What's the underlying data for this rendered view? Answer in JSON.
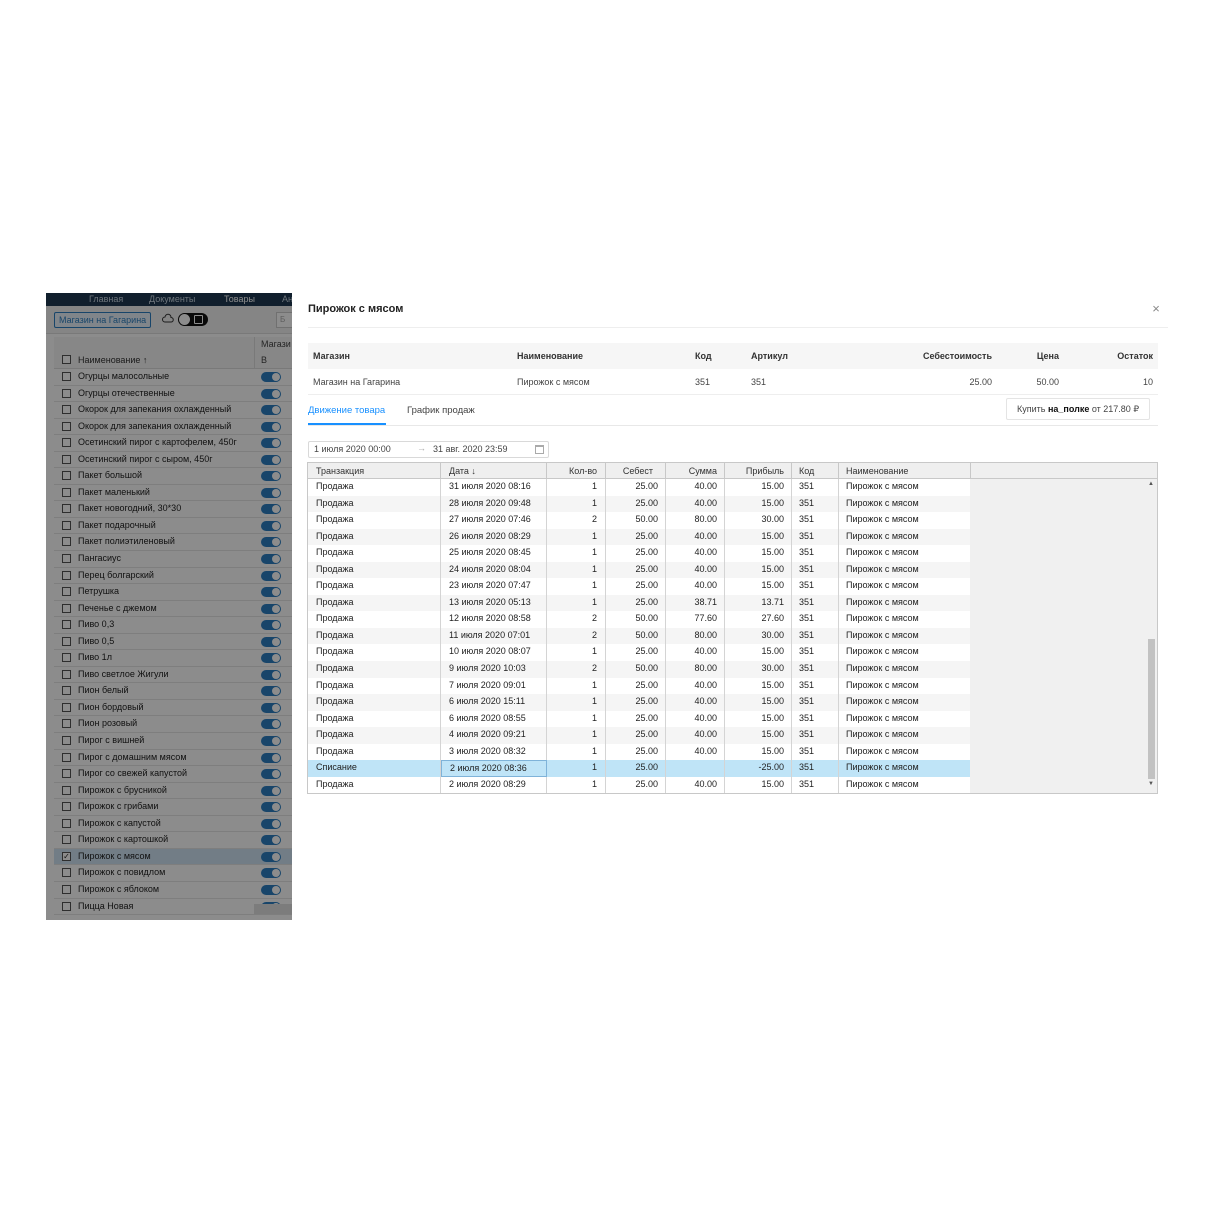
{
  "app": {
    "nav": [
      "Главная",
      "Документы",
      "Товары",
      "Ан"
    ],
    "store_button": "Магазин на Гагарина",
    "search_placeholder": "Б",
    "list_header": {
      "stores_col": "Магази",
      "b_col": "В",
      "name_col": "Наименование ↑"
    },
    "products": [
      "Огурцы малосольные",
      "Огурцы отечественные",
      "Окорок для запекания охлажденный",
      "Окорок для запекания охлажденный",
      "Осетинский пирог с картофелем, 450г",
      "Осетинский пирог с сыром, 450г",
      "Пакет большой",
      "Пакет маленький",
      "Пакет новогодний, 30*30",
      "Пакет подарочный",
      "Пакет полиэтиленовый",
      "Пангасиус",
      "Перец болгарский",
      "Петрушка",
      "Печенье с джемом",
      "Пиво 0,3",
      "Пиво 0,5",
      "Пиво 1л",
      "Пиво светлое Жигули",
      "Пион белый",
      "Пион бордовый",
      "Пион розовый",
      "Пирог с вишней",
      "Пирог с домашним мясом",
      "Пирог со свежей капустой",
      "Пирожок с брусникой",
      "Пирожок с грибами",
      "Пирожок с капустой",
      "Пирожок с картошкой",
      "Пирожок с мясом",
      "Пирожок с повидлом",
      "Пирожок с яблоком",
      "Пицца Новая"
    ],
    "selected_product_index": 29
  },
  "modal": {
    "title": "Пирожок с мясом",
    "close_label": "×",
    "info_headers": {
      "store": "Магазин",
      "name": "Наименование",
      "code": "Код",
      "article": "Артикул",
      "cost": "Себестоимость",
      "price": "Цена",
      "stock": "Остаток"
    },
    "info_values": {
      "store": "Магазин на Гагарина",
      "name": "Пирожок с мясом",
      "code": "351",
      "article": "351",
      "cost": "25.00",
      "price": "50.00",
      "stock": "10"
    },
    "tabs": {
      "movement": "Движение товара",
      "sales_chart": "График продаж"
    },
    "buy": {
      "prefix": "Купить ",
      "brand": "на_полке",
      "suffix": " от 217.80 ₽"
    },
    "date_from": "1 июля 2020 00:00",
    "date_arrow": "→",
    "date_to": "31 авг. 2020 23:59",
    "grid_headers": {
      "transaction": "Транзакция",
      "date": "Дата ↓",
      "qty": "Кол-во",
      "cost": "Себест",
      "sum": "Сумма",
      "profit": "Прибыль",
      "code": "Код",
      "name": "Наименование"
    },
    "rows": [
      [
        "Продажа",
        "31 июля 2020 08:16",
        "1",
        "25.00",
        "40.00",
        "15.00",
        "351",
        "Пирожок с мясом"
      ],
      [
        "Продажа",
        "28 июля 2020 09:48",
        "1",
        "25.00",
        "40.00",
        "15.00",
        "351",
        "Пирожок с мясом"
      ],
      [
        "Продажа",
        "27 июля 2020 07:46",
        "2",
        "50.00",
        "80.00",
        "30.00",
        "351",
        "Пирожок с мясом"
      ],
      [
        "Продажа",
        "26 июля 2020 08:29",
        "1",
        "25.00",
        "40.00",
        "15.00",
        "351",
        "Пирожок с мясом"
      ],
      [
        "Продажа",
        "25 июля 2020 08:45",
        "1",
        "25.00",
        "40.00",
        "15.00",
        "351",
        "Пирожок с мясом"
      ],
      [
        "Продажа",
        "24 июля 2020 08:04",
        "1",
        "25.00",
        "40.00",
        "15.00",
        "351",
        "Пирожок с мясом"
      ],
      [
        "Продажа",
        "23 июля 2020 07:47",
        "1",
        "25.00",
        "40.00",
        "15.00",
        "351",
        "Пирожок с мясом"
      ],
      [
        "Продажа",
        "13 июля 2020 05:13",
        "1",
        "25.00",
        "38.71",
        "13.71",
        "351",
        "Пирожок с мясом"
      ],
      [
        "Продажа",
        "12 июля 2020 08:58",
        "2",
        "50.00",
        "77.60",
        "27.60",
        "351",
        "Пирожок с мясом"
      ],
      [
        "Продажа",
        "11 июля 2020 07:01",
        "2",
        "50.00",
        "80.00",
        "30.00",
        "351",
        "Пирожок с мясом"
      ],
      [
        "Продажа",
        "10 июля 2020 08:07",
        "1",
        "25.00",
        "40.00",
        "15.00",
        "351",
        "Пирожок с мясом"
      ],
      [
        "Продажа",
        "9 июля 2020 10:03",
        "2",
        "50.00",
        "80.00",
        "30.00",
        "351",
        "Пирожок с мясом"
      ],
      [
        "Продажа",
        "7 июля 2020 09:01",
        "1",
        "25.00",
        "40.00",
        "15.00",
        "351",
        "Пирожок с мясом"
      ],
      [
        "Продажа",
        "6 июля 2020 15:11",
        "1",
        "25.00",
        "40.00",
        "15.00",
        "351",
        "Пирожок с мясом"
      ],
      [
        "Продажа",
        "6 июля 2020 08:55",
        "1",
        "25.00",
        "40.00",
        "15.00",
        "351",
        "Пирожок с мясом"
      ],
      [
        "Продажа",
        "4 июля 2020 09:21",
        "1",
        "25.00",
        "40.00",
        "15.00",
        "351",
        "Пирожок с мясом"
      ],
      [
        "Продажа",
        "3 июля 2020 08:32",
        "1",
        "25.00",
        "40.00",
        "15.00",
        "351",
        "Пирожок с мясом"
      ],
      [
        "Списание",
        "2 июля 2020 08:36",
        "1",
        "25.00",
        "",
        "-25.00",
        "351",
        "Пирожок с мясом"
      ],
      [
        "Продажа",
        "2 июля 2020 08:29",
        "1",
        "25.00",
        "40.00",
        "15.00",
        "351",
        "Пирожок с мясом"
      ]
    ],
    "selected_row_index": 17
  }
}
